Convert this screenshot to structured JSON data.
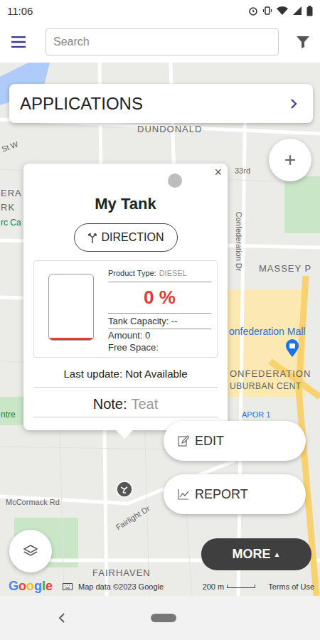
{
  "status_bar": {
    "time": "11:06"
  },
  "top_bar": {
    "search": {
      "placeholder": "Search"
    }
  },
  "applications": {
    "label": "APPLICATIONS"
  },
  "zoom": {
    "label": "+"
  },
  "popup": {
    "title": "My Tank",
    "close": "×",
    "direction": "DIRECTION",
    "product_type_label": "Product Type:",
    "product_type": "DIESEL",
    "percent": "0 %",
    "level": 0,
    "capacity": "Tank Capacity: --",
    "amount": "Amount: 0",
    "free_space": "Free Space:",
    "last_update": "Last update: Not Available",
    "note_label": "Note:",
    "note": "Teat"
  },
  "actions": [
    {
      "label": "EDIT"
    },
    {
      "label": "REPORT"
    }
  ],
  "more": {
    "label": "MORE",
    "arrow": "▲"
  },
  "map": {
    "labels": [
      {
        "text": "DUNDONALD"
      },
      {
        "text": "33rd"
      },
      {
        "text": "MASSEY P"
      },
      {
        "text": "Confederation Dr"
      },
      {
        "text": "onfederation Mall"
      },
      {
        "text": "ONFEDERATION"
      },
      {
        "text": "UBURBAN CENT"
      },
      {
        "text": "APOR 1"
      },
      {
        "text": "McCormack Rd"
      },
      {
        "text": "Fairlight Dr"
      },
      {
        "text": "FAIRHAVEN"
      },
      {
        "text": "ERA"
      },
      {
        "text": "RK"
      },
      {
        "text": "rc Ca"
      },
      {
        "text": "ntre"
      },
      {
        "text": "St W"
      }
    ],
    "attribution": {
      "logo": "Google",
      "data": "Map data ©2023 Google",
      "scale": "200 m",
      "terms": "Terms of Use"
    }
  }
}
